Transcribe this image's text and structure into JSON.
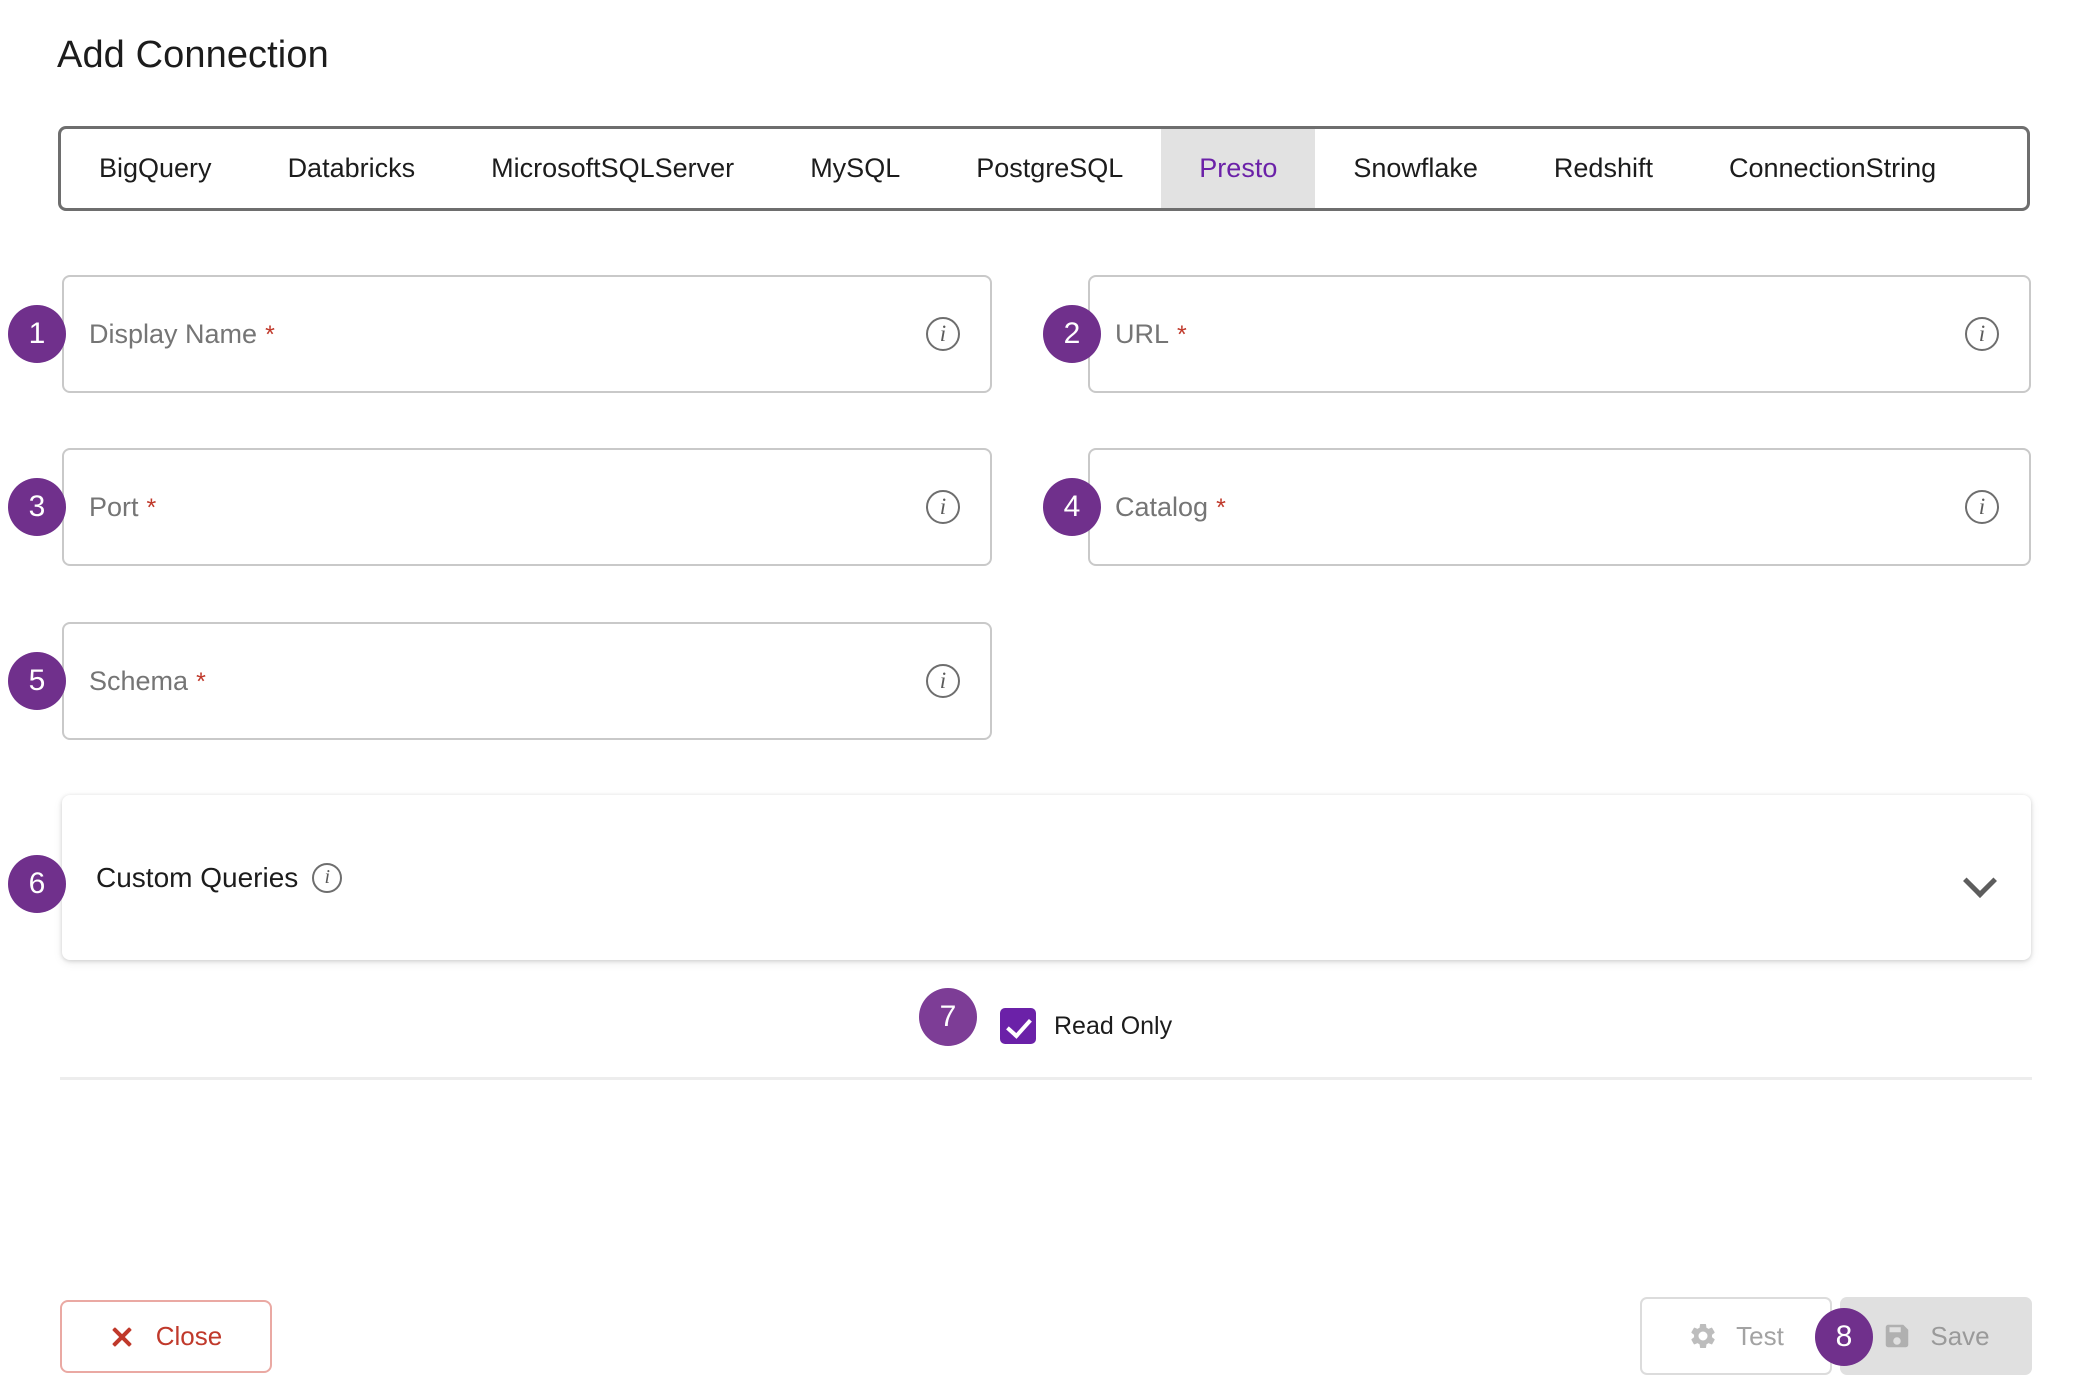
{
  "dialog": {
    "title": "Add Connection"
  },
  "tabs": {
    "items": [
      {
        "label": "BigQuery",
        "active": false
      },
      {
        "label": "Databricks",
        "active": false
      },
      {
        "label": "MicrosoftSQLServer",
        "active": false
      },
      {
        "label": "MySQL",
        "active": false
      },
      {
        "label": "PostgreSQL",
        "active": false
      },
      {
        "label": "Presto",
        "active": true
      },
      {
        "label": "Snowflake",
        "active": false
      },
      {
        "label": "Redshift",
        "active": false
      },
      {
        "label": "ConnectionString",
        "active": false
      }
    ],
    "active_label": "Presto"
  },
  "fields": [
    {
      "label": "Display Name",
      "required": true,
      "value": "",
      "placeholder": "Display Name",
      "info_icon": "info-icon"
    },
    {
      "label": "URL",
      "required": true,
      "value": "",
      "placeholder": "URL",
      "info_icon": "info-icon"
    },
    {
      "label": "Port",
      "required": true,
      "value": "",
      "placeholder": "Port",
      "info_icon": "info-icon"
    },
    {
      "label": "Catalog",
      "required": true,
      "value": "",
      "placeholder": "Catalog",
      "info_icon": "info-icon"
    },
    {
      "label": "Schema",
      "required": true,
      "value": "",
      "placeholder": "Schema",
      "info_icon": "info-icon"
    }
  ],
  "required_marker": "*",
  "custom_queries": {
    "title": "Custom Queries",
    "expanded": false,
    "info_icon": "info-icon",
    "chevron_icon": "chevron-down-icon"
  },
  "read_only": {
    "label": "Read Only",
    "checked": true
  },
  "footer": {
    "close_label": "Close",
    "close_icon": "close-x-icon",
    "test_label": "Test",
    "test_icon": "gear-icon",
    "test_disabled": true,
    "save_label": "Save",
    "save_icon": "floppy-disk-icon",
    "save_disabled": true
  },
  "badges": [
    {
      "number": "1"
    },
    {
      "number": "2"
    },
    {
      "number": "3"
    },
    {
      "number": "4"
    },
    {
      "number": "5"
    },
    {
      "number": "6"
    },
    {
      "number": "7"
    },
    {
      "number": "8"
    }
  ],
  "colors": {
    "accent_purple": "#70308c",
    "tab_active_text": "#6b21a8",
    "tab_active_bg": "#e2e2e2",
    "required_red": "#c0392b",
    "close_red": "#c0392b",
    "checkbox_purple": "#6b21a8",
    "disabled_gray": "#9a9a9a",
    "field_border": "#c9c9c9"
  }
}
